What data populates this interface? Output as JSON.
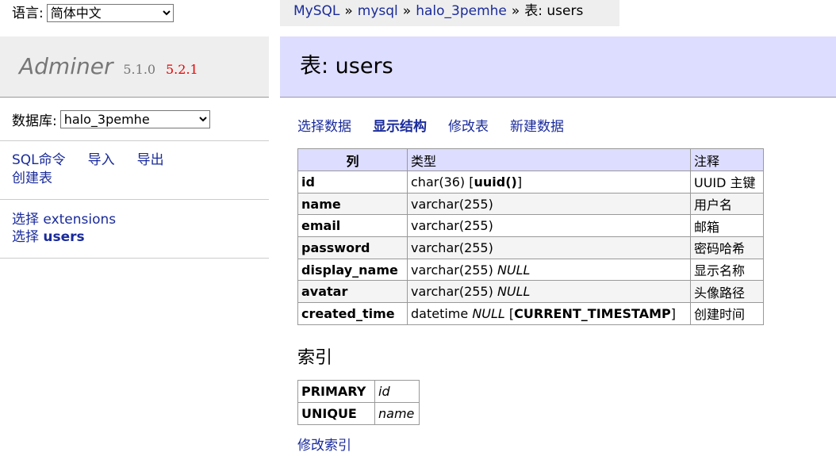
{
  "lang": {
    "label": "语言:",
    "selected": "简体中文"
  },
  "menu": {
    "app_name": "Adminer",
    "version": "5.1.0",
    "new_version": "5.2.1",
    "db_label": "数据库:",
    "db_selected": "halo_3pemhe",
    "links": {
      "sql": "SQL命令",
      "import": "导入",
      "export": "导出",
      "create_table": "创建表"
    },
    "tables": [
      {
        "select": "选择",
        "name": "extensions"
      },
      {
        "select": "选择",
        "name": "users"
      }
    ]
  },
  "breadcrumb": {
    "items": [
      "MySQL",
      "mysql",
      "halo_3pemhe"
    ],
    "separator": "»",
    "current": "表: users"
  },
  "title": "表: users",
  "actions": {
    "select": "选择数据",
    "structure": "显示结构",
    "alter": "修改表",
    "new": "新建数据"
  },
  "structure": {
    "headers": {
      "column": "列",
      "type": "类型",
      "comment": "注释"
    },
    "rows": [
      {
        "name": "id",
        "type": "char(36)",
        "null": "",
        "default": "uuid()",
        "comment": "UUID 主键"
      },
      {
        "name": "name",
        "type": "varchar(255)",
        "null": "",
        "default": "",
        "comment": "用户名"
      },
      {
        "name": "email",
        "type": "varchar(255)",
        "null": "",
        "default": "",
        "comment": "邮箱"
      },
      {
        "name": "password",
        "type": "varchar(255)",
        "null": "",
        "default": "",
        "comment": "密码哈希"
      },
      {
        "name": "display_name",
        "type": "varchar(255)",
        "null": "NULL",
        "default": "",
        "comment": "显示名称"
      },
      {
        "name": "avatar",
        "type": "varchar(255)",
        "null": "NULL",
        "default": "",
        "comment": "头像路径"
      },
      {
        "name": "created_time",
        "type": "datetime",
        "null": "NULL",
        "default": "CURRENT_TIMESTAMP",
        "comment": "创建时间"
      }
    ]
  },
  "indexes": {
    "title": "索引",
    "rows": [
      {
        "type": "PRIMARY",
        "column": "id"
      },
      {
        "type": "UNIQUE",
        "column": "name"
      }
    ],
    "alter_link": "修改索引"
  }
}
